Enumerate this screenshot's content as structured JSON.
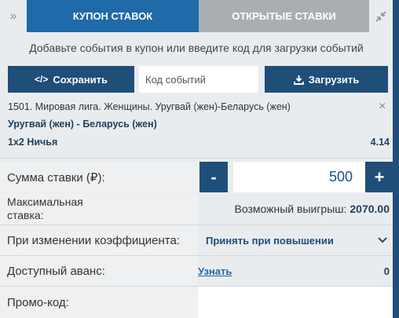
{
  "tabs": {
    "coupon": "Купон ставок",
    "open": "Открытые ставки"
  },
  "icons": {
    "expand": "double-chevron-right-icon",
    "collapse": "collapse-arrows-icon",
    "code": "code-icon",
    "download": "download-icon",
    "close": "close-icon",
    "chevron": "chevron-down-icon"
  },
  "hint": "Добавьте события в купон или введите код для загрузки событий",
  "actions": {
    "save_label": "Сохранить",
    "code_placeholder": "Код событий",
    "load_label": "Загрузить"
  },
  "event": {
    "title": "1501. Мировая лига. Женщины. Уругвай (жен)-Беларусь (жен)",
    "match": "Уругвай (жен) - Беларусь (жен)",
    "market": "1x2 Ничья",
    "odds": "4.14"
  },
  "stake": {
    "label": "Сумма ставки (₽):",
    "minus": "-",
    "plus": "+",
    "value": "500"
  },
  "max_stake": {
    "label": "Максимальная ставка:",
    "win_label": "Возможный выигрыш:",
    "win_value": "2070.00"
  },
  "odds_change": {
    "label": "При изменении коэффициента:",
    "selected": "Принять при повышении"
  },
  "advance": {
    "label": "Доступный аванс:",
    "link": "Узнать",
    "value": "0"
  },
  "promo": {
    "label": "Промо-код:"
  },
  "colors": {
    "primary": "#1f4e79",
    "active_tab": "#1f6aa8",
    "inactive_tab": "#a9aeb3"
  }
}
